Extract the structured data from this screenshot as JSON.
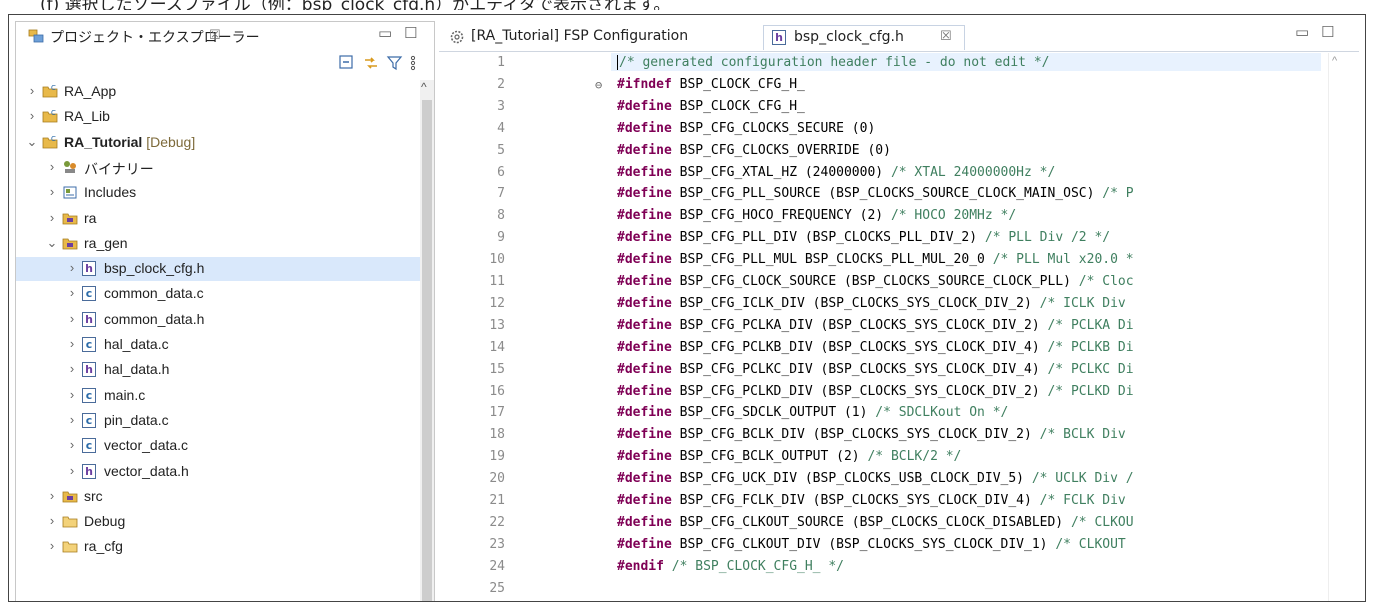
{
  "top_caption": "(f) 選択したソースファイル（例：bsp_clock_cfg.h）がエディタで表示されます。",
  "explorer": {
    "title": "プロジェクト・エクスプローラー",
    "close_glyph": "☒",
    "minimize_glyph": "▭",
    "maximize_glyph": "☐",
    "items": [
      {
        "chev": "›",
        "icon": "project-icon",
        "label": "RA_App",
        "extra": ""
      },
      {
        "chev": "›",
        "icon": "project-icon",
        "label": "RA_Lib",
        "extra": ""
      },
      {
        "chev": "⌄",
        "icon": "project-icon",
        "label": "RA_Tutorial",
        "extra": " [Debug]"
      },
      {
        "chev": "›",
        "icon": "binaries-icon",
        "label": "バイナリー",
        "extra": ""
      },
      {
        "chev": "›",
        "icon": "includes-icon",
        "label": "Includes",
        "extra": ""
      },
      {
        "chev": "›",
        "icon": "source-folder-icon",
        "label": "ra",
        "extra": ""
      },
      {
        "chev": "⌄",
        "icon": "source-folder-icon",
        "label": "ra_gen",
        "extra": ""
      },
      {
        "chev": "›",
        "icon": "h",
        "label": "bsp_clock_cfg.h",
        "extra": ""
      },
      {
        "chev": "›",
        "icon": "c",
        "label": "common_data.c",
        "extra": ""
      },
      {
        "chev": "›",
        "icon": "h",
        "label": "common_data.h",
        "extra": ""
      },
      {
        "chev": "›",
        "icon": "c",
        "label": "hal_data.c",
        "extra": ""
      },
      {
        "chev": "›",
        "icon": "h",
        "label": "hal_data.h",
        "extra": ""
      },
      {
        "chev": "›",
        "icon": "c",
        "label": "main.c",
        "extra": ""
      },
      {
        "chev": "›",
        "icon": "c",
        "label": "pin_data.c",
        "extra": ""
      },
      {
        "chev": "›",
        "icon": "c",
        "label": "vector_data.c",
        "extra": ""
      },
      {
        "chev": "›",
        "icon": "h",
        "label": "vector_data.h",
        "extra": ""
      },
      {
        "chev": "›",
        "icon": "source-folder-icon",
        "label": "src",
        "extra": ""
      },
      {
        "chev": "›",
        "icon": "folder-icon",
        "label": "Debug",
        "extra": ""
      },
      {
        "chev": "›",
        "icon": "folder-icon",
        "label": "ra_cfg",
        "extra": ""
      }
    ]
  },
  "editor": {
    "tabs": [
      {
        "label": "[RA_Tutorial] FSP Configuration",
        "icon": "gear-icon",
        "active": false
      },
      {
        "label": "bsp_clock_cfg.h",
        "icon": "h",
        "active": true,
        "close": "☒"
      }
    ],
    "lines": [
      {
        "n": "1",
        "kw": "",
        "code": "",
        "cm": "/* generated configuration header file - do not edit */"
      },
      {
        "n": "2",
        "kw": "#ifndef",
        "code": " BSP_CLOCK_CFG_H_",
        "cm": ""
      },
      {
        "n": "3",
        "kw": "#define",
        "code": " BSP_CLOCK_CFG_H_",
        "cm": ""
      },
      {
        "n": "4",
        "kw": "#define",
        "code": " BSP_CFG_CLOCKS_SECURE (0)",
        "cm": ""
      },
      {
        "n": "5",
        "kw": "#define",
        "code": " BSP_CFG_CLOCKS_OVERRIDE (0)",
        "cm": ""
      },
      {
        "n": "6",
        "kw": "#define",
        "code": " BSP_CFG_XTAL_HZ (24000000) ",
        "cm": "/* XTAL 24000000Hz */"
      },
      {
        "n": "7",
        "kw": "#define",
        "code": " BSP_CFG_PLL_SOURCE (BSP_CLOCKS_SOURCE_CLOCK_MAIN_OSC) ",
        "cm": "/* P"
      },
      {
        "n": "8",
        "kw": "#define",
        "code": " BSP_CFG_HOCO_FREQUENCY (2) ",
        "cm": "/* HOCO 20MHz */"
      },
      {
        "n": "9",
        "kw": "#define",
        "code": " BSP_CFG_PLL_DIV (BSP_CLOCKS_PLL_DIV_2) ",
        "cm": "/* PLL Div /2 */"
      },
      {
        "n": "10",
        "kw": "#define",
        "code": " BSP_CFG_PLL_MUL BSP_CLOCKS_PLL_MUL_20_0 ",
        "cm": "/* PLL Mul x20.0 *"
      },
      {
        "n": "11",
        "kw": "#define",
        "code": " BSP_CFG_CLOCK_SOURCE (BSP_CLOCKS_SOURCE_CLOCK_PLL) ",
        "cm": "/* Cloc"
      },
      {
        "n": "12",
        "kw": "#define",
        "code": " BSP_CFG_ICLK_DIV (BSP_CLOCKS_SYS_CLOCK_DIV_2) ",
        "cm": "/* ICLK Div"
      },
      {
        "n": "13",
        "kw": "#define",
        "code": " BSP_CFG_PCLKA_DIV (BSP_CLOCKS_SYS_CLOCK_DIV_2) ",
        "cm": "/* PCLKA Di"
      },
      {
        "n": "14",
        "kw": "#define",
        "code": " BSP_CFG_PCLKB_DIV (BSP_CLOCKS_SYS_CLOCK_DIV_4) ",
        "cm": "/* PCLKB Di"
      },
      {
        "n": "15",
        "kw": "#define",
        "code": " BSP_CFG_PCLKC_DIV (BSP_CLOCKS_SYS_CLOCK_DIV_4) ",
        "cm": "/* PCLKC Di"
      },
      {
        "n": "16",
        "kw": "#define",
        "code": " BSP_CFG_PCLKD_DIV (BSP_CLOCKS_SYS_CLOCK_DIV_2) ",
        "cm": "/* PCLKD Di"
      },
      {
        "n": "17",
        "kw": "#define",
        "code": " BSP_CFG_SDCLK_OUTPUT (1) ",
        "cm": "/* SDCLKout On */"
      },
      {
        "n": "18",
        "kw": "#define",
        "code": " BSP_CFG_BCLK_DIV (BSP_CLOCKS_SYS_CLOCK_DIV_2) ",
        "cm": "/* BCLK Div"
      },
      {
        "n": "19",
        "kw": "#define",
        "code": " BSP_CFG_BCLK_OUTPUT (2) ",
        "cm": "/* BCLK/2 */"
      },
      {
        "n": "20",
        "kw": "#define",
        "code": " BSP_CFG_UCK_DIV (BSP_CLOCKS_USB_CLOCK_DIV_5) ",
        "cm": "/* UCLK Div /"
      },
      {
        "n": "21",
        "kw": "#define",
        "code": " BSP_CFG_FCLK_DIV (BSP_CLOCKS_SYS_CLOCK_DIV_4) ",
        "cm": "/* FCLK Div"
      },
      {
        "n": "22",
        "kw": "#define",
        "code": " BSP_CFG_CLKOUT_SOURCE (BSP_CLOCKS_CLOCK_DISABLED) ",
        "cm": "/* CLKOU"
      },
      {
        "n": "23",
        "kw": "#define",
        "code": " BSP_CFG_CLKOUT_DIV (BSP_CLOCKS_SYS_CLOCK_DIV_1) ",
        "cm": "/* CLKOUT"
      },
      {
        "n": "24",
        "kw": "#endif",
        "code": " ",
        "cm": "/* BSP_CLOCK_CFG_H_ */"
      },
      {
        "n": "25",
        "kw": "",
        "code": "",
        "cm": ""
      }
    ]
  }
}
